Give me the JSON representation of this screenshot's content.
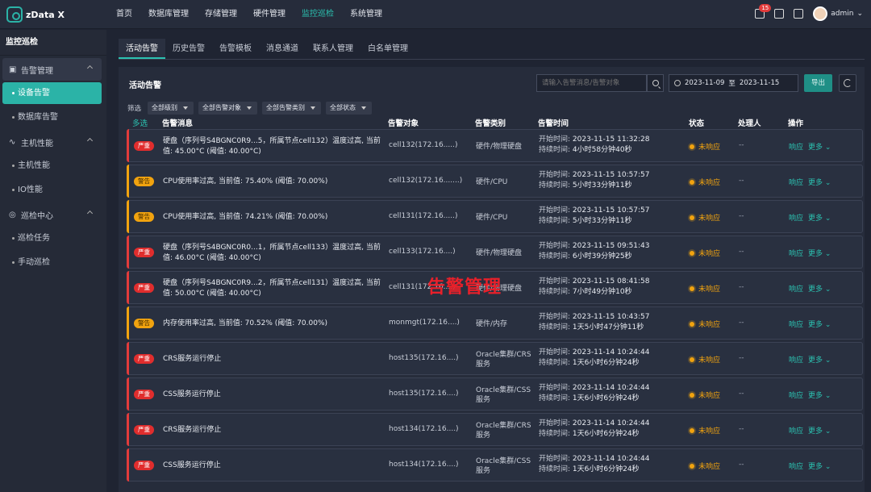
{
  "app": {
    "name": "zData X"
  },
  "nav": {
    "items": [
      "首页",
      "数据库管理",
      "存储管理",
      "硬件管理",
      "监控巡检",
      "系统管理"
    ],
    "active": "监控巡检"
  },
  "topbar": {
    "notification_count": "15",
    "user": "admin"
  },
  "sidebar": {
    "title": "监控巡检",
    "groups": [
      {
        "label": "告警管理",
        "items": [
          "设备告警",
          "数据库告警"
        ]
      },
      {
        "label": "主机性能",
        "items": [
          "主机性能",
          "IO性能"
        ]
      },
      {
        "label": "巡检中心",
        "items": [
          "巡检任务",
          "手动巡检"
        ]
      }
    ]
  },
  "tabs": [
    "活动告警",
    "历史告警",
    "告警模板",
    "消息通道",
    "联系人管理",
    "白名单管理"
  ],
  "panel": {
    "title": "活动告警",
    "search_placeholder": "请输入告警消息/告警对象",
    "date_start": "2023-11-09",
    "date_to": "至",
    "date_end": "2023-11-15",
    "export": "导出"
  },
  "filters": {
    "label": "筛选",
    "selects": [
      "全部级别",
      "全部告警对象",
      "全部告警类别",
      "全部状态"
    ]
  },
  "table": {
    "headers": [
      "多选",
      "告警消息",
      "告警对象",
      "告警类别",
      "告警时间",
      "状态",
      "处理人",
      "操作"
    ],
    "start_label": "开始时间:",
    "duration_label": "持续时间:",
    "op_respond": "响应",
    "op_more": "更多",
    "rows": [
      {
        "severity": "严重",
        "level": "serious",
        "message": "硬盘（序列号S4BGNC0R9...5，所属节点cell132）温度过高, 当前值: 45.00°C (阈值: 40.00°C)",
        "target": "cell132(172.16.....)",
        "category": "硬件/物理硬盘",
        "start": "2023-11-15 11:32:28",
        "duration": "4小时58分钟40秒",
        "status": "未响应",
        "handler": "--"
      },
      {
        "severity": "警告",
        "level": "warn",
        "message": "CPU使用率过高, 当前值: 75.40% (阈值: 70.00%)",
        "target": "cell132(172.16.......)",
        "category": "硬件/CPU",
        "start": "2023-11-15 10:57:57",
        "duration": "5小时33分钟11秒",
        "status": "未响应",
        "handler": "--"
      },
      {
        "severity": "警告",
        "level": "warn",
        "message": "CPU使用率过高, 当前值: 74.21% (阈值: 70.00%)",
        "target": "cell131(172.16.....)",
        "category": "硬件/CPU",
        "start": "2023-11-15 10:57:57",
        "duration": "5小时33分钟11秒",
        "status": "未响应",
        "handler": "--"
      },
      {
        "severity": "严重",
        "level": "serious",
        "message": "硬盘（序列号S4BGNC0R0...1，所属节点cell133）温度过高, 当前值: 46.00°C (阈值: 40.00°C)",
        "target": "cell133(172.16....)",
        "category": "硬件/物理硬盘",
        "start": "2023-11-15 09:51:43",
        "duration": "6小时39分钟25秒",
        "status": "未响应",
        "handler": "--"
      },
      {
        "severity": "严重",
        "level": "serious",
        "message": "硬盘（序列号S4BGNC0R9...2，所属节点cell131）温度过高, 当前值: 50.00°C (阈值: 40.00°C)",
        "target": "cell131(172.16....)",
        "category": "硬件/物理硬盘",
        "start": "2023-11-15 08:41:58",
        "duration": "7小时49分钟10秒",
        "status": "未响应",
        "handler": "--"
      },
      {
        "severity": "警告",
        "level": "warn",
        "message": "内存使用率过高, 当前值: 70.52% (阈值: 70.00%)",
        "target": "monmgt(172.16....)",
        "category": "硬件/内存",
        "start": "2023-11-15 10:43:57",
        "duration": "1天5小时47分钟11秒",
        "status": "未响应",
        "handler": "--"
      },
      {
        "severity": "严重",
        "level": "serious",
        "message": "CRS服务运行停止",
        "target": "host135(172.16....)",
        "category": "Oracle集群/CRS服务",
        "start": "2023-11-14 10:24:44",
        "duration": "1天6小时6分钟24秒",
        "status": "未响应",
        "handler": "--"
      },
      {
        "severity": "严重",
        "level": "serious",
        "message": "CSS服务运行停止",
        "target": "host135(172.16....)",
        "category": "Oracle集群/CSS服务",
        "start": "2023-11-14 10:24:44",
        "duration": "1天6小时6分钟24秒",
        "status": "未响应",
        "handler": "--"
      },
      {
        "severity": "严重",
        "level": "serious",
        "message": "CRS服务运行停止",
        "target": "host134(172.16....)",
        "category": "Oracle集群/CRS服务",
        "start": "2023-11-14 10:24:44",
        "duration": "1天6小时6分钟24秒",
        "status": "未响应",
        "handler": "--"
      },
      {
        "severity": "严重",
        "level": "serious",
        "message": "CSS服务运行停止",
        "target": "host134(172.16....)",
        "category": "Oracle集群/CSS服务",
        "start": "2023-11-14 10:24:44",
        "duration": "1天6小时6分钟24秒",
        "status": "未响应",
        "handler": "--"
      }
    ]
  },
  "overlay": {
    "text": "告警管理",
    "color": "#e8202a"
  }
}
